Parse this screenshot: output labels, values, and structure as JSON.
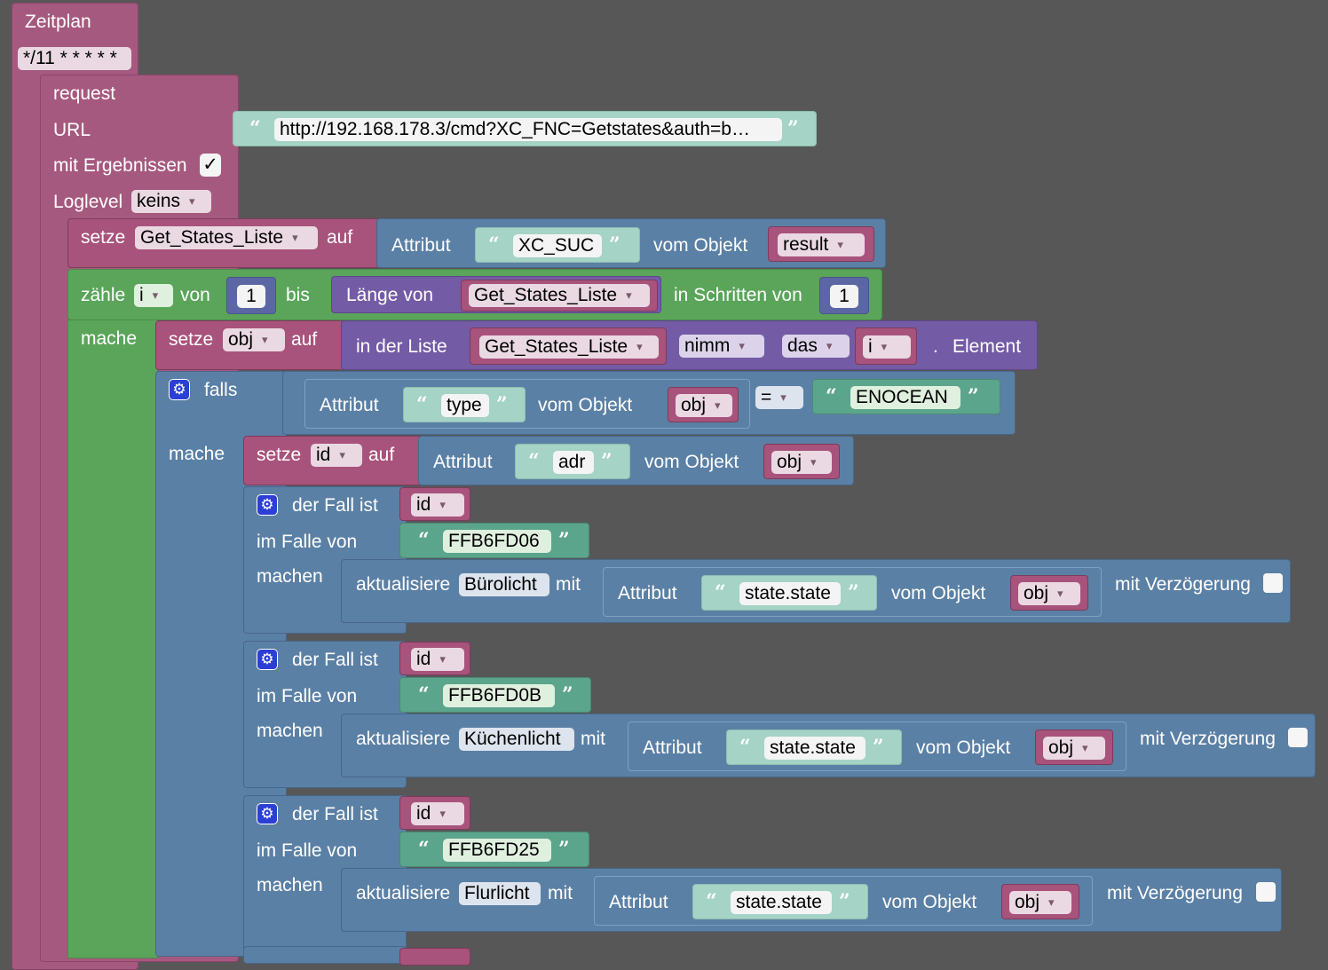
{
  "schedule": {
    "title": "Zeitplan",
    "cron": "*/11 * * * * *"
  },
  "request": {
    "title": "request",
    "url_label": "URL",
    "url_value": "http://192.168.178.3/cmd?XC_FNC=Getstates&auth=b…",
    "results_label": "mit Ergebnissen",
    "results_check": "✓",
    "loglevel_label": "Loglevel",
    "loglevel_value": "keins"
  },
  "set_list": {
    "setze": "setze",
    "var": "Get_States_Liste",
    "auf": "auf",
    "attr_label": "Attribut",
    "attr_value": "XC_SUC",
    "obj_label": "vom Objekt",
    "obj_value": "result"
  },
  "loop": {
    "zaehle": "zähle",
    "var": "i",
    "von": "von",
    "from": "1",
    "bis": "bis",
    "len_label": "Länge von",
    "len_var": "Get_States_Liste",
    "step_label": "in Schritten von",
    "step": "1",
    "mache": "mache"
  },
  "set_obj": {
    "setze": "setze",
    "var": "obj",
    "auf": "auf",
    "in_list": "in der Liste",
    "list_var": "Get_States_Liste",
    "nimm": "nimm",
    "das": "das",
    "idx": "i",
    "dot": ".",
    "element": "Element"
  },
  "if_block": {
    "falls": "falls",
    "mache": "mache",
    "attr_label": "Attribut",
    "attr_value": "type",
    "obj_label": "vom Objekt",
    "obj_value": "obj",
    "op": "=",
    "compare": "ENOCEAN"
  },
  "set_id": {
    "setze": "setze",
    "var": "id",
    "auf": "auf",
    "attr_label": "Attribut",
    "attr_value": "adr",
    "obj_label": "vom Objekt",
    "obj_value": "obj"
  },
  "cases": [
    {
      "fall_label": "der Fall ist",
      "fall_var": "id",
      "im_falle": "im Falle von",
      "value": "FFB6FD06",
      "machen": "machen",
      "update": "aktualisiere",
      "target": "Bürolicht",
      "mit": "mit",
      "attr_label": "Attribut",
      "attr_value": "state.state",
      "obj_label": "vom Objekt",
      "obj_value": "obj",
      "delay_label": "mit Verzögerung"
    },
    {
      "fall_label": "der Fall ist",
      "fall_var": "id",
      "im_falle": "im Falle von",
      "value": "FFB6FD0B",
      "machen": "machen",
      "update": "aktualisiere",
      "target": "Küchenlicht",
      "mit": "mit",
      "attr_label": "Attribut",
      "attr_value": "state.state",
      "obj_label": "vom Objekt",
      "obj_value": "obj",
      "delay_label": "mit Verzögerung"
    },
    {
      "fall_label": "der Fall ist",
      "fall_var": "id",
      "im_falle": "im Falle von",
      "value": "FFB6FD25",
      "machen": "machen",
      "update": "aktualisiere",
      "target": "Flurlicht",
      "mit": "mit",
      "attr_label": "Attribut",
      "attr_value": "state.state",
      "obj_label": "vom Objekt",
      "obj_value": "obj",
      "delay_label": "mit Verzögerung"
    }
  ],
  "icons": {
    "gear": "gear-icon",
    "checkbox": "checkbox-icon",
    "dropdown": "chevron-down-icon"
  },
  "colors": {
    "schedule": "#a6597f",
    "loop": "#5ba55b",
    "logic": "#5b80a5",
    "list": "#745ba5",
    "text": "#5ba58c",
    "canvas": "#575757"
  }
}
